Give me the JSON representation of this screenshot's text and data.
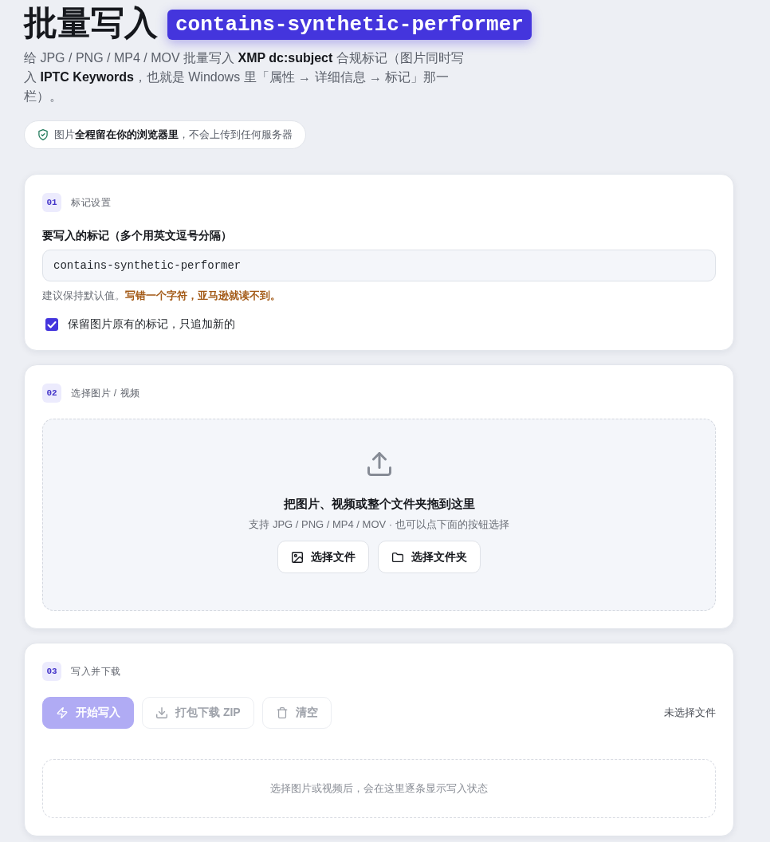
{
  "header": {
    "title": "批量写入",
    "tag": "contains-synthetic-performer",
    "description": "给 JPG / PNG / MP4 / MOV 批量写入 **XMP dc:subject** 合规标记（图片同时写入 **IPTC Keywords**，也就是 Windows 里「属性 → 详细信息 → 标记」那一栏）。",
    "privacy_note": "图片**全程留在你的浏览器里**，不会上传到任何服务器"
  },
  "sections": [
    {
      "kind": "settings",
      "step": "01",
      "title": "标记设置",
      "field": {
        "label": "要写入的标记（多个用英文逗号分隔）",
        "value": "contains-synthetic-performer"
      },
      "hint": "建议保持默认值。**写错一个字符，亚马逊就读不到。**",
      "checkbox": {
        "label": "保留图片原有的标记，只追加新的",
        "checked": true
      }
    },
    {
      "kind": "upload",
      "step": "02",
      "title": "选择图片 / 视频",
      "dropzone": {
        "title": "把图片、视频或整个文件夹拖到这里",
        "subtitle": "支持 JPG / PNG / MP4 / MOV · 也可以点下面的按钮选择",
        "buttons": [
          {
            "label": "选择文件",
            "disabled": false
          },
          {
            "label": "选择文件夹",
            "disabled": false
          }
        ]
      }
    },
    {
      "kind": "process",
      "step": "03",
      "title": "写入并下载",
      "buttons": [
        {
          "label": "开始写入",
          "kind": "primary",
          "disabled": true
        },
        {
          "label": "打包下载 ZIP",
          "kind": "secondary",
          "disabled": true
        },
        {
          "label": "清空",
          "kind": "secondary",
          "disabled": true
        }
      ],
      "file_status": "未选择文件",
      "log_placeholder": "选择图片或视频后，会在这里逐条显示写入状态"
    }
  ]
}
